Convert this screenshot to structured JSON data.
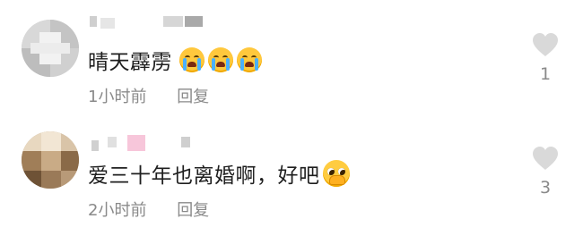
{
  "comments": [
    {
      "text": "晴天霹雳",
      "emojis": [
        "crying-face",
        "crying-face",
        "crying-face"
      ],
      "time": "1小时前",
      "reply_label": "回复",
      "likes": "1",
      "avatar": "pixelated-avatar"
    },
    {
      "text": "爱三十年也离婚啊，好吧",
      "emojis": [
        "pleading-face"
      ],
      "time": "2小时前",
      "reply_label": "回复",
      "likes": "3",
      "avatar": "pixelated-avatar"
    }
  ],
  "colors": {
    "text": "#1f1f1f",
    "meta": "#8a8a8a",
    "heart": "#d9d9d9",
    "background": "#ffffff"
  },
  "icons": {
    "like": "heart-icon"
  }
}
